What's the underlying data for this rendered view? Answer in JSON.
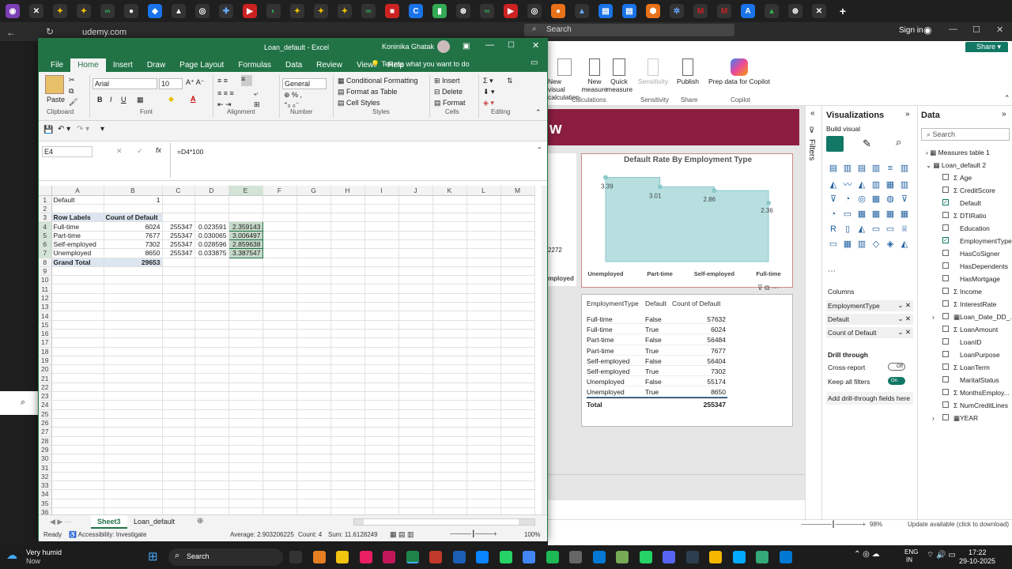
{
  "browser": {
    "tab_url": "udemy.com",
    "search_placeholder": "Search",
    "signin": "Sign in"
  },
  "pbi": {
    "share": "Share",
    "ribbon": [
      {
        "label": "New visual",
        "sub": "calculation"
      },
      {
        "label": "New measure"
      },
      {
        "label": "Quick measure"
      },
      {
        "label": "Sensitivity"
      },
      {
        "label": "Publish"
      },
      {
        "label": "Prep data for Copilot"
      }
    ],
    "ribbon_groups": [
      "Calculations",
      "Sensitivity",
      "Share",
      "Copilot"
    ],
    "chart": {
      "title": "Default Rate By Employment Type"
    },
    "chart_data": {
      "type": "area",
      "title": "Default Rate By Employment Type",
      "categories": [
        "Unemployed",
        "Part-time",
        "Self-employed",
        "Full-time"
      ],
      "values": [
        3.39,
        3.01,
        2.86,
        2.36
      ],
      "data_labels": [
        "3.39",
        "3.01",
        "2.86",
        "2.36"
      ],
      "color": "#b7dfe0"
    },
    "left_visual": {
      "value": "2272",
      "label": "mployed"
    },
    "table": {
      "headers": [
        "EmploymentType",
        "Default",
        "Count of Default"
      ],
      "rows": [
        [
          "Full-time",
          "False",
          "57632"
        ],
        [
          "Full-time",
          "True",
          "6024"
        ],
        [
          "Part-time",
          "False",
          "56484"
        ],
        [
          "Part-time",
          "True",
          "7677"
        ],
        [
          "Self-employed",
          "False",
          "56404"
        ],
        [
          "Self-employed",
          "True",
          "7302"
        ],
        [
          "Unemployed",
          "False",
          "55174"
        ],
        [
          "Unemployed",
          "True",
          "8650"
        ]
      ],
      "total_label": "Total",
      "total": "255347"
    },
    "filters_label": "Filters",
    "viz": {
      "title": "Visualizations",
      "build": "Build visual",
      "columns_label": "Columns",
      "columns": [
        "EmploymentType",
        "Default",
        "Count of Default"
      ],
      "drill_label": "Drill through",
      "cross_report": "Cross-report",
      "cross_state": "Off",
      "keep_filters": "Keep all filters",
      "keep_state": "On",
      "add_drill": "Add drill-through fields here"
    },
    "data": {
      "title": "Data",
      "search": "Search",
      "measures": "Measures table 1",
      "table": "Loan_default 2",
      "fields": [
        {
          "n": "Age",
          "s": "Σ",
          "c": false
        },
        {
          "n": "CreditScore",
          "s": "Σ",
          "c": false
        },
        {
          "n": "Default",
          "s": "",
          "c": true
        },
        {
          "n": "DTIRatio",
          "s": "Σ",
          "c": false
        },
        {
          "n": "Education",
          "s": "",
          "c": false
        },
        {
          "n": "EmploymentType",
          "s": "",
          "c": true
        },
        {
          "n": "HasCoSigner",
          "s": "",
          "c": false
        },
        {
          "n": "HasDependents",
          "s": "",
          "c": false
        },
        {
          "n": "HasMortgage",
          "s": "",
          "c": false
        },
        {
          "n": "Income",
          "s": "Σ",
          "c": false
        },
        {
          "n": "InterestRate",
          "s": "Σ",
          "c": false
        },
        {
          "n": "Loan_Date_DD_...",
          "s": "▦",
          "c": false
        },
        {
          "n": "LoanAmount",
          "s": "Σ",
          "c": false
        },
        {
          "n": "LoanID",
          "s": "",
          "c": false
        },
        {
          "n": "LoanPurpose",
          "s": "",
          "c": false
        },
        {
          "n": "LoanTerm",
          "s": "Σ",
          "c": false
        },
        {
          "n": "MaritalStatus",
          "s": "",
          "c": false
        },
        {
          "n": "MonthsEmploy...",
          "s": "Σ",
          "c": false
        },
        {
          "n": "NumCreditLines",
          "s": "Σ",
          "c": false
        },
        {
          "n": "YEAR",
          "s": "▦",
          "c": false
        }
      ]
    },
    "zoom": "98%",
    "update": "Update available (click to download)"
  },
  "excel": {
    "title": "Loan_default - Excel",
    "user": "Koninika Ghatak",
    "tabs": [
      "File",
      "Home",
      "Insert",
      "Draw",
      "Page Layout",
      "Formulas",
      "Data",
      "Review",
      "View",
      "Help"
    ],
    "tell": "Tell me what you want to do",
    "font": "Arial",
    "size": "10",
    "numfmt": "General",
    "ribbon": {
      "paste": "Paste",
      "cond": "Conditional Formatting",
      "fmt_table": "Format as Table",
      "cell_styles": "Cell Styles",
      "insert": "Insert",
      "delete": "Delete",
      "format": "Format"
    },
    "groups": [
      "Clipboard",
      "Font",
      "Alignment",
      "Number",
      "Styles",
      "Cells",
      "Editing"
    ],
    "namebox": "E4",
    "formula": "=D4*100",
    "cols": [
      "A",
      "B",
      "C",
      "D",
      "E",
      "F",
      "G",
      "H",
      "I",
      "J",
      "K",
      "L",
      "M"
    ],
    "rows": [
      [
        "Default",
        "1",
        "",
        "",
        "",
        "",
        "",
        "",
        "",
        "",
        "",
        "",
        ""
      ],
      [
        "",
        "",
        "",
        "",
        "",
        "",
        "",
        "",
        "",
        "",
        "",
        "",
        ""
      ],
      [
        "Row Labels",
        "Count of Default",
        "",
        "",
        "",
        "",
        "",
        "",
        "",
        "",
        "",
        "",
        ""
      ],
      [
        "Full-time",
        "6024",
        "255347",
        "0.023591",
        "2.359143",
        "",
        "",
        "",
        "",
        "",
        "",
        "",
        ""
      ],
      [
        "Part-time",
        "7677",
        "255347",
        "0.030065",
        "3.006497",
        "",
        "",
        "",
        "",
        "",
        "",
        "",
        ""
      ],
      [
        "Self-employed",
        "7302",
        "255347",
        "0.028596",
        "2.859638",
        "",
        "",
        "",
        "",
        "",
        "",
        "",
        ""
      ],
      [
        "Unemployed",
        "8650",
        "255347",
        "0.033875",
        "3.387547",
        "",
        "",
        "",
        "",
        "",
        "",
        "",
        ""
      ],
      [
        "Grand Total",
        "29653",
        "",
        "",
        "",
        "",
        "",
        "",
        "",
        "",
        "",
        "",
        ""
      ]
    ],
    "sheets": [
      "Sheet3",
      "Loan_default"
    ],
    "status": {
      "ready": "Ready",
      "access": "Accessibility: Investigate",
      "average": "Average: 2.903206225",
      "count": "Count: 4",
      "sum": "Sum: 11.6128249",
      "zoom": "100%"
    }
  },
  "taskbar": {
    "weather": "Very humid",
    "weather_sub": "Now",
    "search": "Search",
    "lang": "ENG",
    "lang2": "IN",
    "time": "17:22",
    "date": "29-10-2025"
  }
}
